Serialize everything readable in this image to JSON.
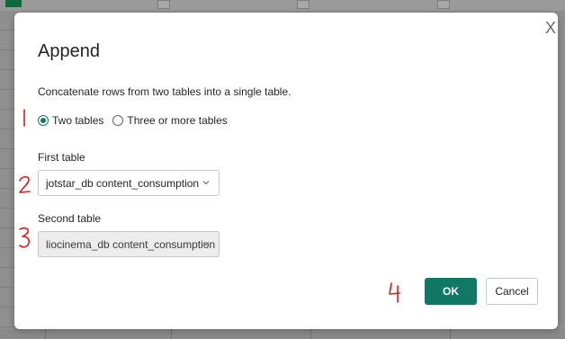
{
  "dialog": {
    "title": "Append",
    "description": "Concatenate rows from two tables into a single table.",
    "close_glyph": "X",
    "options": {
      "two_tables": "Two tables",
      "three_or_more": "Three or more tables",
      "selected": "Two tables"
    },
    "first_table": {
      "label": "First table",
      "value": "jotstar_db content_consumption"
    },
    "second_table": {
      "label": "Second table",
      "value": "liocinema_db content_consumption"
    },
    "ok_label": "OK",
    "cancel_label": "Cancel"
  },
  "annotations": [
    "1",
    "2",
    "3",
    "4"
  ],
  "colors": {
    "accent": "#117865",
    "annotation": "#e01818"
  }
}
